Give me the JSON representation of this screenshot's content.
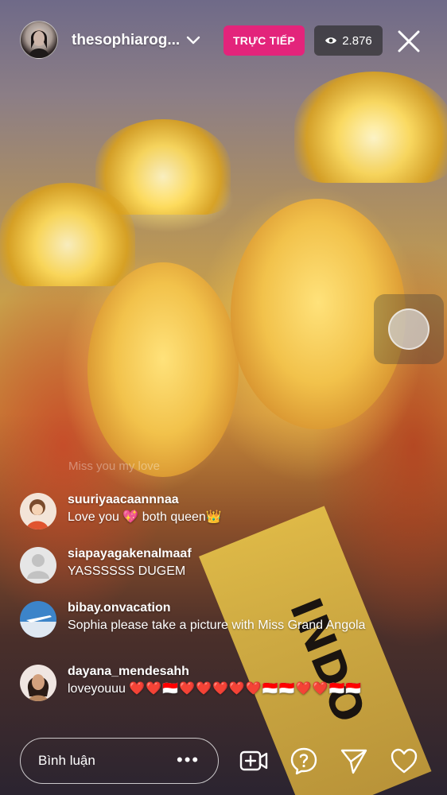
{
  "header": {
    "username": "thesophiarog...",
    "live_label": "TRỰC TIẾP",
    "viewer_count": "2.876"
  },
  "overlay": {
    "faded_comment": "Miss you my love"
  },
  "sash": {
    "text": "INDO"
  },
  "comments": [
    {
      "username": "suuriyaacaannnaa",
      "text": "Love you 💖 both queen👑",
      "avatar": "cartoon-avatar"
    },
    {
      "username": "siapayagakenalmaaf",
      "text": "YASSSSSS DUGEM",
      "avatar": "default-avatar"
    },
    {
      "username": "bibay.onvacation",
      "text": "Sophia please take a picture with Miss Grand Angola",
      "avatar": "airplane-avatar"
    },
    {
      "username": "dayana_mendesahh",
      "text_prefix": "loveyouuu ",
      "text_emoji": "❤️❤️🇮🇩❤️❤️❤️❤️❤️🇮🇩🇮🇩❤️❤️🇮🇩🇮🇩",
      "avatar": "portrait-avatar"
    }
  ],
  "bottom_bar": {
    "comment_placeholder": "Bình luận",
    "more_label": "•••",
    "icons": [
      "add-video-icon",
      "question-icon",
      "send-icon",
      "heart-icon"
    ]
  },
  "colors": {
    "live_badge": "#e3247b",
    "viewer_badge_bg": "rgba(40,40,40,0.65)",
    "heart_red": "#e01e2e"
  }
}
